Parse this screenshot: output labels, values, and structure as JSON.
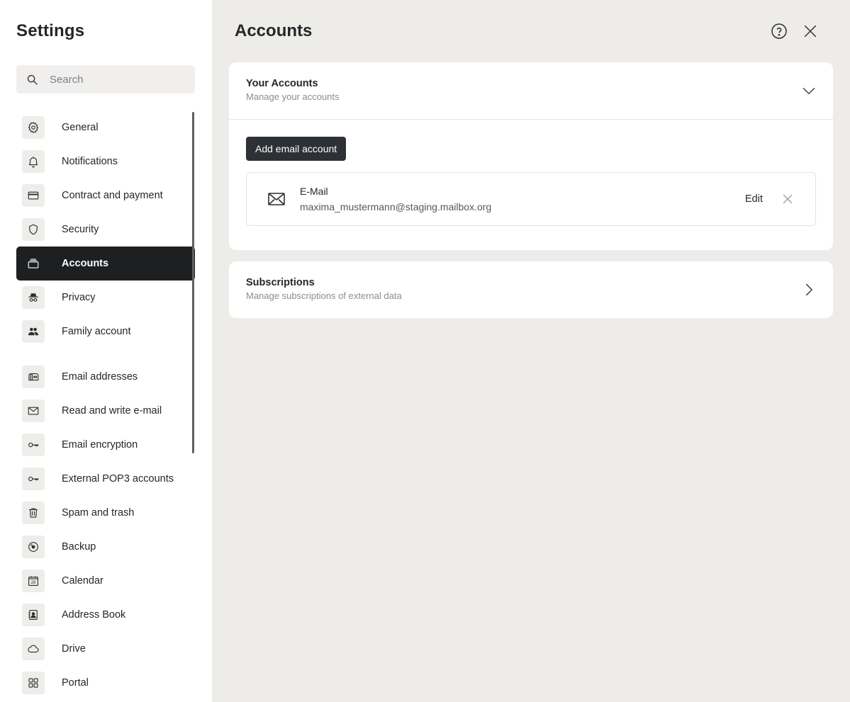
{
  "sidebar": {
    "title": "Settings",
    "search_placeholder": "Search",
    "items": [
      {
        "label": "General",
        "icon": "gear-icon"
      },
      {
        "label": "Notifications",
        "icon": "bell-icon"
      },
      {
        "label": "Contract and payment",
        "icon": "credit-card-icon"
      },
      {
        "label": "Security",
        "icon": "shield-icon"
      },
      {
        "label": "Accounts",
        "icon": "accounts-stack-icon",
        "active": true
      },
      {
        "label": "Privacy",
        "icon": "incognito-icon"
      },
      {
        "label": "Family account",
        "icon": "people-icon"
      },
      {
        "label": "Email addresses",
        "icon": "mailbox-icon"
      },
      {
        "label": "Read and write e-mail",
        "icon": "envelope-icon"
      },
      {
        "label": "Email encryption",
        "icon": "key-icon"
      },
      {
        "label": "External POP3 accounts",
        "icon": "key-icon"
      },
      {
        "label": "Spam and trash",
        "icon": "trash-icon"
      },
      {
        "label": "Backup",
        "icon": "disc-icon"
      },
      {
        "label": "Calendar",
        "icon": "calendar-icon",
        "calendar_day": "28"
      },
      {
        "label": "Address Book",
        "icon": "contact-book-icon"
      },
      {
        "label": "Drive",
        "icon": "cloud-icon"
      },
      {
        "label": "Portal",
        "icon": "grid-icon"
      }
    ]
  },
  "main": {
    "title": "Accounts",
    "your_accounts": {
      "title": "Your Accounts",
      "subtitle": "Manage your accounts",
      "add_button": "Add email account",
      "accounts": [
        {
          "type": "E-Mail",
          "address": "maxima_mustermann@staging.mailbox.org",
          "edit_label": "Edit"
        }
      ]
    },
    "subscriptions": {
      "title": "Subscriptions",
      "subtitle": "Manage subscriptions of external data"
    }
  },
  "colors": {
    "sidebar_bg": "#ffffff",
    "main_bg": "#eeece9",
    "active_item_bg": "#1d1f21",
    "button_bg": "#2d3034"
  }
}
